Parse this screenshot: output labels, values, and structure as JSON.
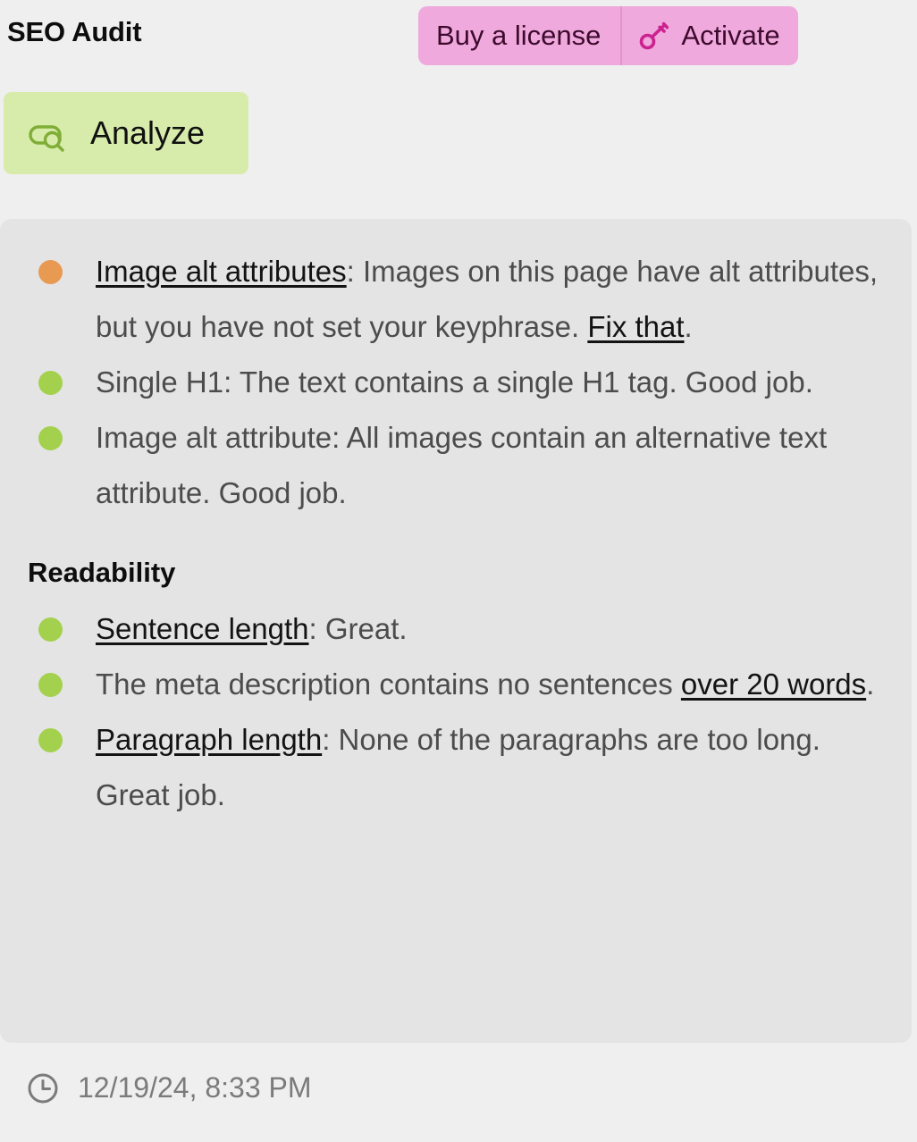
{
  "header": {
    "title": "SEO Audit",
    "buy_license_label": "Buy a license",
    "activate_label": "Activate",
    "key_icon": "key-icon",
    "pink_bg": "#efa9dc",
    "pink_text": "#3d0a2e",
    "key_color": "#cc2290"
  },
  "toolbar": {
    "analyze_label": "Analyze",
    "analyze_icon": "analyze-search-icon",
    "analyze_bg": "#d7ecab",
    "analyze_icon_color": "#7fad36"
  },
  "card": {
    "bg": "#e4e4e4",
    "seo_findings": [
      {
        "status": "warn",
        "dot_color": "#e89a52",
        "link_text": "Image alt attributes",
        "text_after_link": ": Images on this page have alt attributes, but you have not set your keyphrase. ",
        "second_link_text": "Fix that",
        "text_end": "."
      },
      {
        "status": "good",
        "dot_color": "#a3d14e",
        "text": "Single H1: The text contains a single H1 tag. Good job."
      },
      {
        "status": "good",
        "dot_color": "#a3d14e",
        "text": "Image alt attribute: All images contain an alternative text attribute. Good job."
      }
    ],
    "readability_heading": "Readability",
    "readability_findings": [
      {
        "status": "good",
        "dot_color": "#a3d14e",
        "link_text": "Sentence length",
        "text_after_link": ": Great."
      },
      {
        "status": "good",
        "dot_color": "#a3d14e",
        "text_before_link": "The meta description contains no sentences ",
        "link_text": "over 20 words",
        "text_after_link": "."
      },
      {
        "status": "good",
        "dot_color": "#a3d14e",
        "link_text": "Paragraph length",
        "text_after_link": ": None of the paragraphs are too long. Great job."
      }
    ]
  },
  "footer": {
    "clock_icon": "clock-icon",
    "timestamp": "12/19/24, 8:33 PM",
    "text_color": "#7b7b7b"
  }
}
